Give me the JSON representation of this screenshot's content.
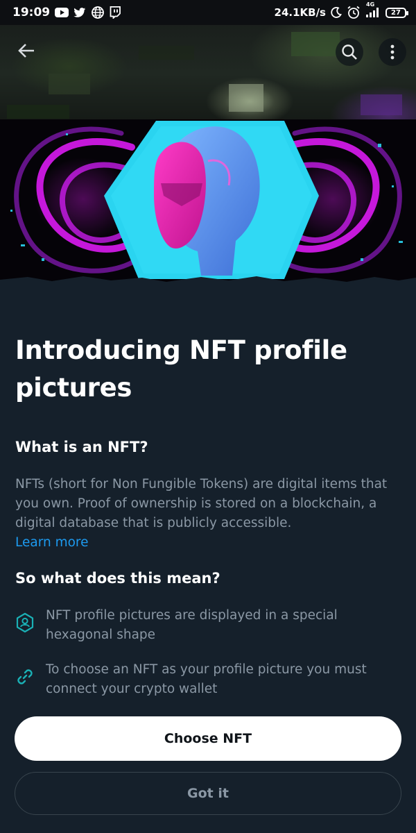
{
  "status_bar": {
    "time": "19:09",
    "network_speed": "24.1KB/s",
    "network_type": "4G",
    "battery": "27",
    "icons": [
      "youtube-icon",
      "twitter-icon",
      "globe-icon",
      "twitch-icon",
      "moon-icon",
      "alarm-icon",
      "signal-icon",
      "battery-icon"
    ]
  },
  "toolbar": {
    "back_icon": "arrow-left-icon",
    "search_icon": "search-icon",
    "more_icon": "more-vertical-icon"
  },
  "content": {
    "title": "Introducing NFT profile pictures",
    "what_heading": "What is an NFT?",
    "what_body": "NFTs (short for Non Fungible Tokens) are digital items that you own. Proof of ownership is stored on a blockchain, a digital database that is publicly accessible.",
    "learn_more": "Learn more",
    "so_heading": "So what does this mean?",
    "bullets": [
      {
        "icon": "hexagon-profile-icon",
        "text": "NFT profile pictures are displayed in a special hexagonal shape"
      },
      {
        "icon": "link-icon",
        "text": "To choose an NFT as your profile picture you must connect your crypto wallet"
      }
    ]
  },
  "actions": {
    "primary_label": "Choose NFT",
    "secondary_label": "Got it"
  },
  "colors": {
    "background": "#15202b",
    "accent": "#1d9bf0",
    "muted_text": "#8b98a5",
    "neon_pink": "#e81cff",
    "neon_cyan": "#2ad4f0"
  }
}
